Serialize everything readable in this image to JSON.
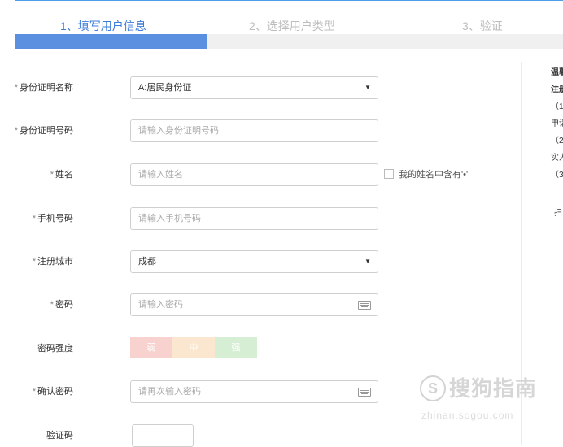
{
  "steps": [
    {
      "label": "1、填写用户信息"
    },
    {
      "label": "2、选择用户类型"
    },
    {
      "label": "3、验证"
    }
  ],
  "progress": {
    "fraction": 0.35
  },
  "form": {
    "id_type": {
      "required": "*",
      "label": "身份证明名称",
      "value": "A:居民身份证"
    },
    "id_number": {
      "required": "*",
      "label": "身份证明号码",
      "placeholder": "请输入身份证明号码"
    },
    "name": {
      "required": "*",
      "label": "姓名",
      "placeholder": "请输入姓名",
      "dot_option": "我的姓名中含有'•'"
    },
    "phone": {
      "required": "*",
      "label": "手机号码",
      "placeholder": "请输入手机号码"
    },
    "city": {
      "required": "*",
      "label": "注册城市",
      "value": "成都"
    },
    "password": {
      "required": "*",
      "label": "密码",
      "placeholder": "请输入密码"
    },
    "strength": {
      "label": "密码强度",
      "weak": "弱",
      "medium": "中",
      "strong": "强"
    },
    "confirm_password": {
      "required": "*",
      "label": "确认密码",
      "placeholder": "请再次输入密码"
    },
    "captcha": {
      "label": "验证码"
    }
  },
  "tips": {
    "lines": [
      "温馨",
      "注册",
      "（1",
      "申请",
      "（2",
      "实人",
      "（3",
      "扫"
    ]
  },
  "watermark": {
    "logo": "S",
    "title": "搜狗指南",
    "sub": "zhinan.sogou.com"
  }
}
